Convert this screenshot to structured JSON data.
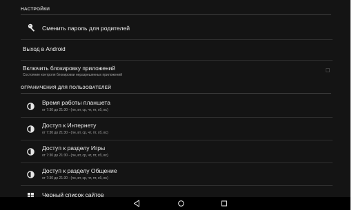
{
  "settings_header": "НАСТРОЙКИ",
  "change_password": {
    "label": "Сменить пароль для родителей",
    "icon": "key-icon"
  },
  "exit_android": {
    "label": "Выход в Android"
  },
  "app_block": {
    "title": "Включить блокировку приложений",
    "subtitle": "Состояние контроля блокировки неразрешенных приложений",
    "checked": false
  },
  "restrictions_header": "ОГРАНИЧЕНИЯ ДЛЯ ПОЛЬЗОВАТЕЛЕЙ",
  "restrictions": [
    {
      "title": "Время работы планшета",
      "subtitle": "от 7:30 до 21:30 - (пн, вт, ср, чт, пт, сб, вс)",
      "icon": "half-moon-icon"
    },
    {
      "title": "Доступ к Интернету",
      "subtitle": "от 7:30 до 21:30 - (пн, вт, ср, чт, пт, сб, вс)",
      "icon": "half-moon-icon"
    },
    {
      "title": "Доступ к разделу Игры",
      "subtitle": "от 7:30 до 21:30 - (пн, вт, ср, чт, пт, сб, вс)",
      "icon": "half-moon-icon"
    },
    {
      "title": "Доступ к разделу Общение",
      "subtitle": "от 7:30 до 21:30 - (пн, вт, ср, чт, пт, сб, вс)",
      "icon": "half-moon-icon"
    },
    {
      "title": "Черный список сайтов",
      "icon": "grid-icon"
    }
  ],
  "navbar": {
    "back_icon": "back-icon",
    "home_icon": "home-icon",
    "recents_icon": "recents-icon"
  },
  "colors": {
    "background": "#141414",
    "divider": "#2f2f2f",
    "navbar": "#000000"
  }
}
